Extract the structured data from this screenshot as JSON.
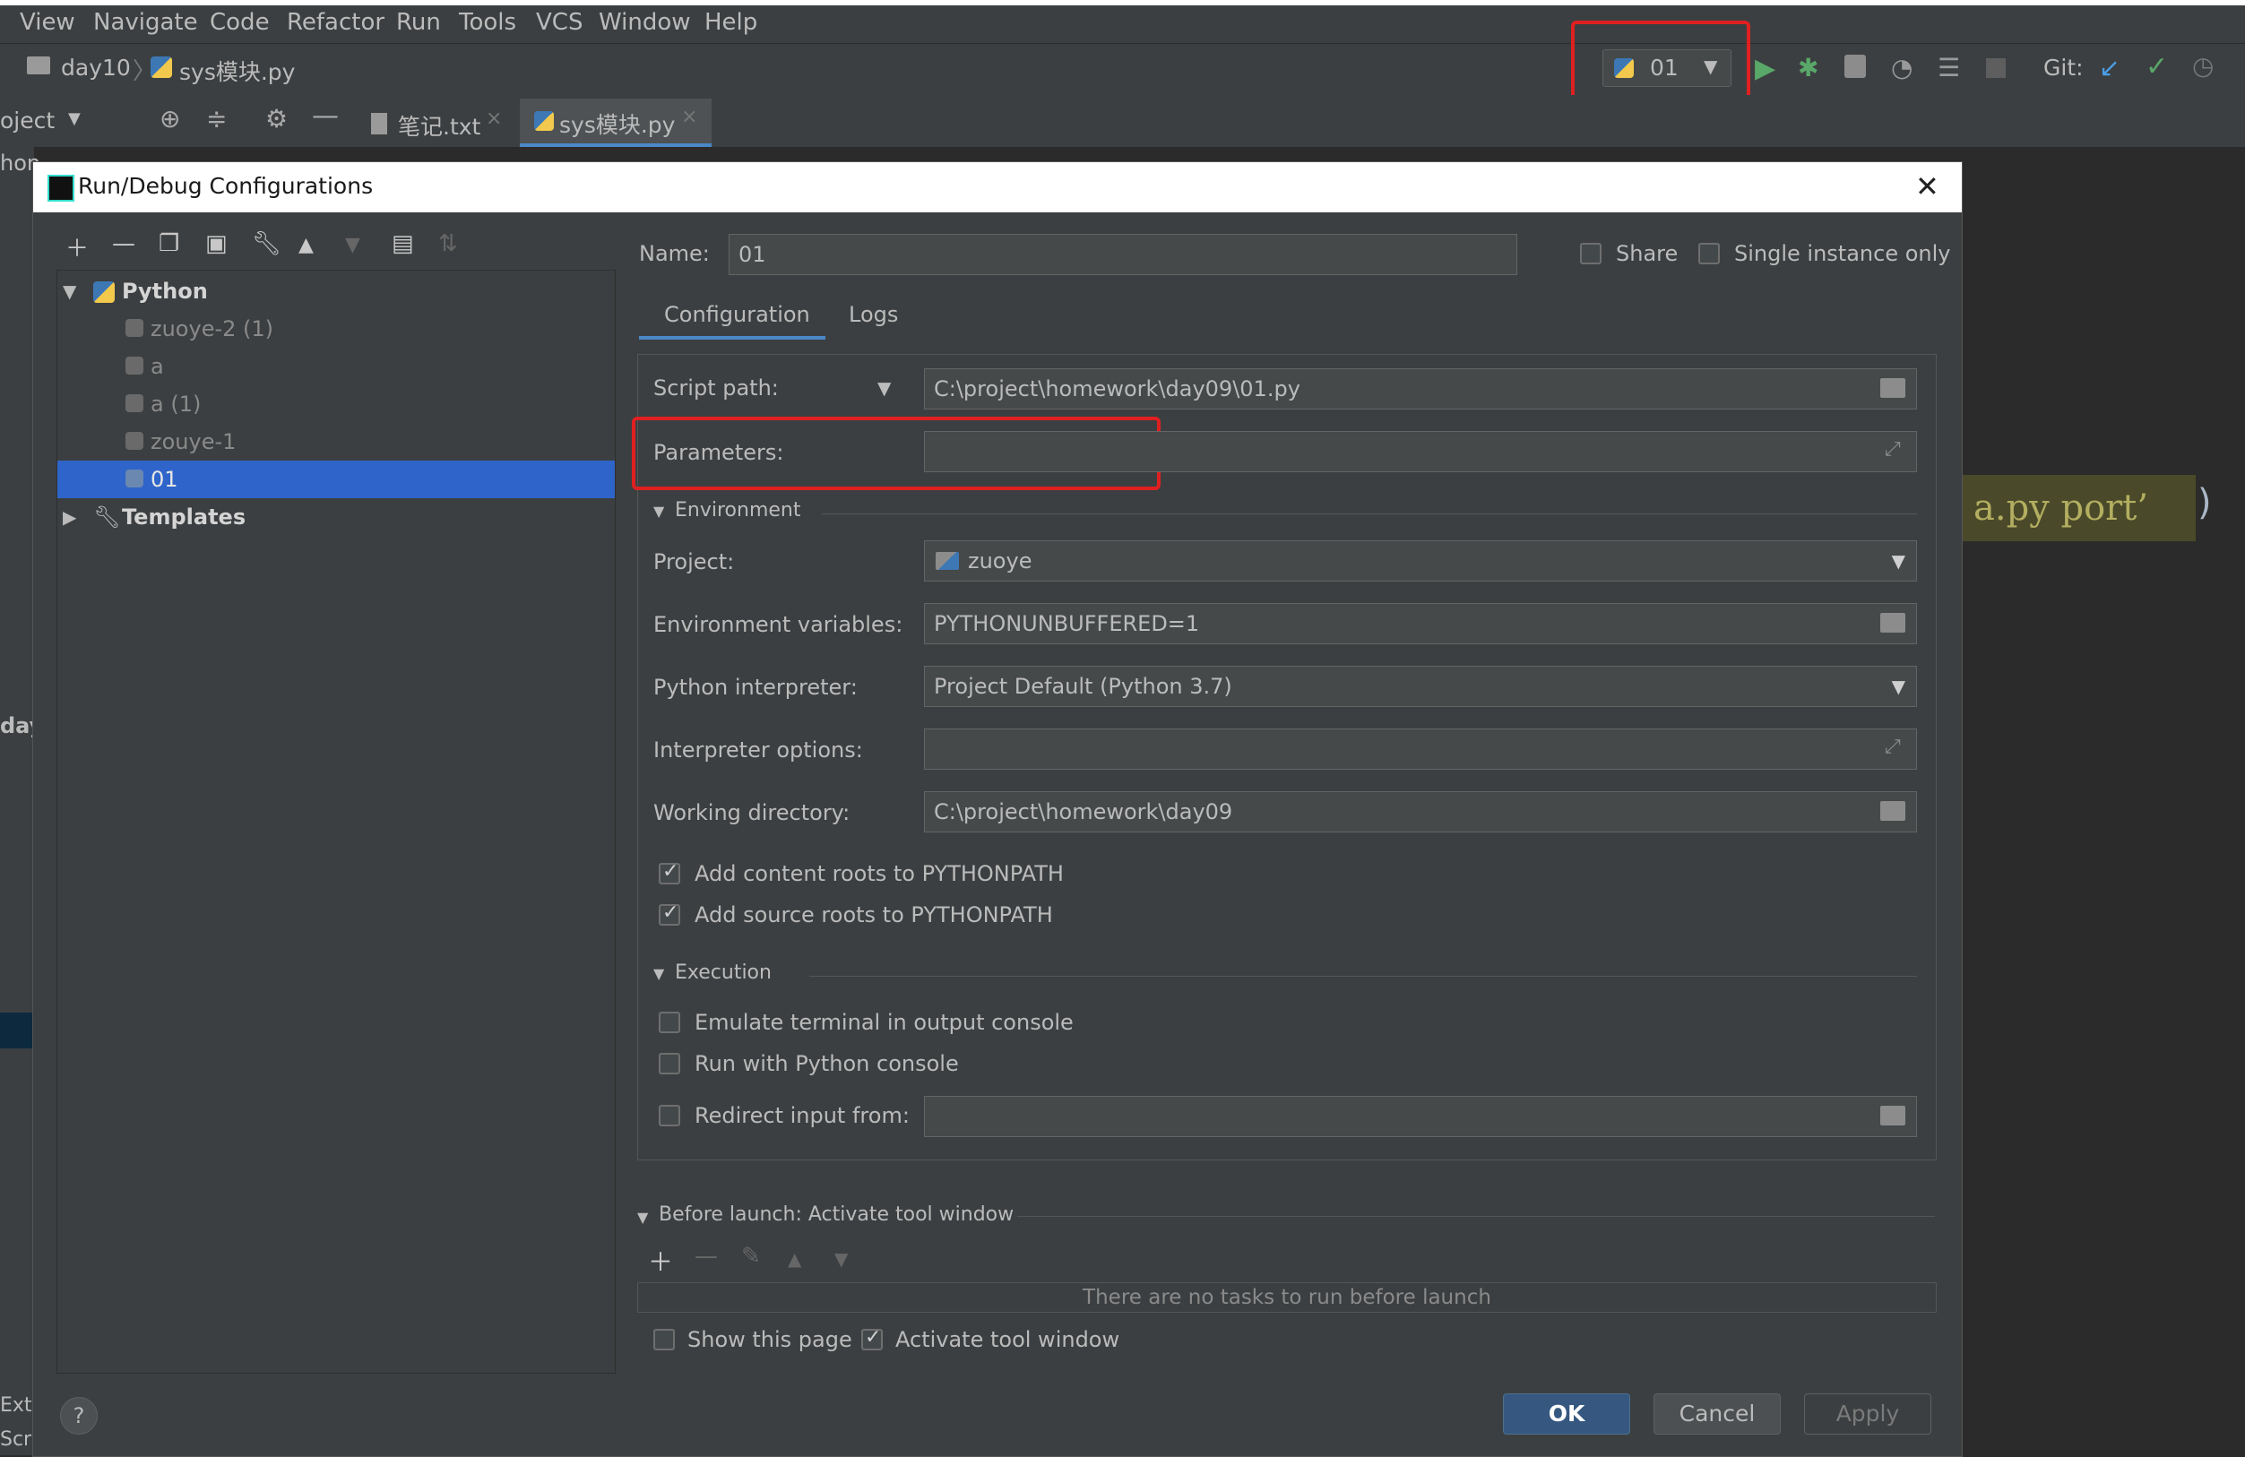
{
  "menu": [
    "View",
    "Navigate",
    "Code",
    "Refactor",
    "Run",
    "Tools",
    "VCS",
    "Window",
    "Help"
  ],
  "breadcrumb": {
    "folder": "day10",
    "file": "sys模块.py"
  },
  "run_config": {
    "selected": "01"
  },
  "git_label": "Git:",
  "project_panel": {
    "label": "oject"
  },
  "tabs": [
    {
      "label": "笔记.txt"
    },
    {
      "label": "sys模块.py"
    }
  ],
  "left_stub_text": {
    "t1": "hon",
    "t2": "day",
    "t3": "Ext",
    "t4": "Scr"
  },
  "editor_snippet": "a.py port’",
  "editor_paren": ")",
  "dialog": {
    "title": "Run/Debug Configurations",
    "tree": {
      "root": "Python",
      "items": [
        "zuoye-2 (1)",
        "a",
        "a (1)",
        "zouye-1",
        "01"
      ],
      "templates": "Templates"
    },
    "name_label": "Name:",
    "name_value": "01",
    "share_label": "Share",
    "single_instance_label": "Single instance only",
    "tabs": [
      "Configuration",
      "Logs"
    ],
    "script_path_label": "Script path:",
    "script_path_value": "C:\\project\\homework\\day09\\01.py",
    "parameters_label": "Parameters:",
    "parameters_value": "",
    "environment_section": "Environment",
    "project_label": "Project:",
    "project_value": "zuoye",
    "env_vars_label": "Environment variables:",
    "env_vars_value": "PYTHONUNBUFFERED=1",
    "interpreter_label": "Python interpreter:",
    "interpreter_value": "Project Default (Python 3.7)",
    "interp_options_label": "Interpreter options:",
    "interp_options_value": "",
    "workdir_label": "Working directory:",
    "workdir_value": "C:\\project\\homework\\day09",
    "add_content_roots": "Add content roots to PYTHONPATH",
    "add_source_roots": "Add source roots to PYTHONPATH",
    "execution_section": "Execution",
    "emulate_terminal": "Emulate terminal in output console",
    "run_with_console": "Run with Python console",
    "redirect_input": "Redirect input from:",
    "before_launch": "Before launch: Activate tool window",
    "no_tasks": "There are no tasks to run before launch",
    "show_page": "Show this page",
    "activate_tool": "Activate tool window",
    "ok": "OK",
    "cancel": "Cancel",
    "apply": "Apply",
    "help": "?"
  },
  "colors": {
    "accent": "#365880",
    "highlight": "#e02020",
    "selection": "#2f65ca",
    "run_green": "#59a869"
  }
}
